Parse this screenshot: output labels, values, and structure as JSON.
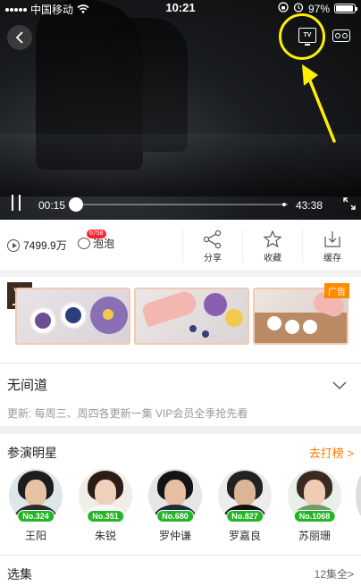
{
  "status_bar": {
    "carrier": "中国移动",
    "time": "10:21",
    "battery": "97%"
  },
  "player": {
    "current_time": "00:15",
    "total_time": "43:38",
    "progress_fraction": 0.005,
    "tv_label": "TV",
    "annotation_color": "#ffee00"
  },
  "actions": {
    "views": "7499.9万",
    "bubble_label": "泡泡",
    "bubble_badge": "6758",
    "share_label": "分享",
    "collect_label": "收藏",
    "download_label": "缓存"
  },
  "ad": {
    "tag": "广告"
  },
  "show": {
    "title": "无间道",
    "update_info": "更新: 每周三、周四各更新一集 VIP会员全季抢先看"
  },
  "cast": {
    "header": "参演明星",
    "more": "去打榜 >",
    "members": [
      {
        "name": "王阳",
        "rank": "No.324"
      },
      {
        "name": "朱锐",
        "rank": "No.351"
      },
      {
        "name": "罗仲谦",
        "rank": "No.680"
      },
      {
        "name": "罗嘉良",
        "rank": "No.827"
      },
      {
        "name": "苏丽珊",
        "rank": "No.1068"
      }
    ]
  },
  "episodes": {
    "title": "选集",
    "count": "12集全>"
  },
  "colors": {
    "accent_orange": "#ff7a00",
    "rank_green": "#24b527",
    "badge_red": "#ff2233"
  }
}
